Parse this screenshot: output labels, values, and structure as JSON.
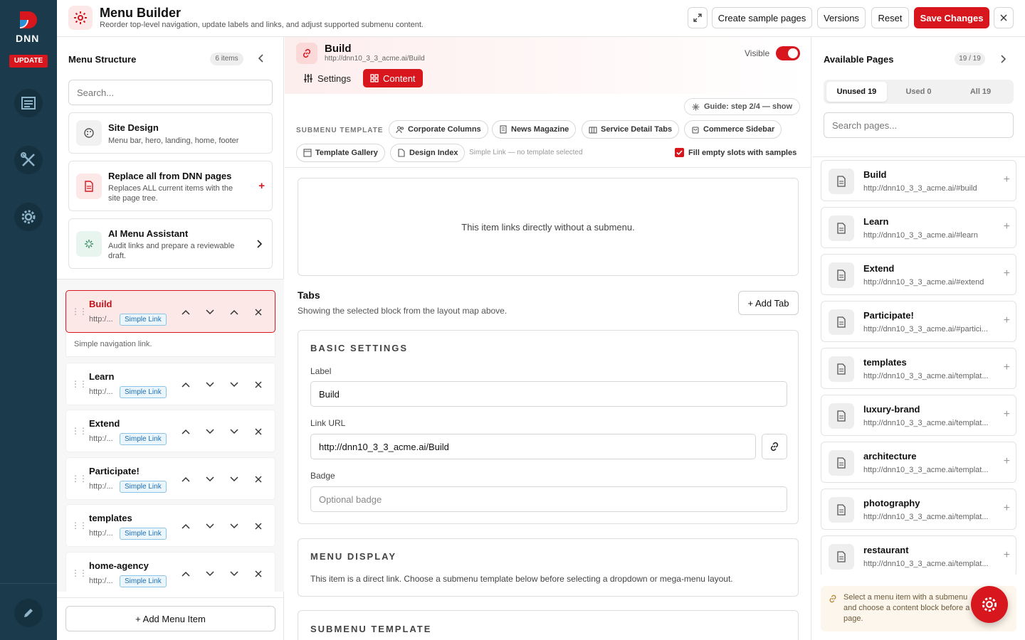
{
  "brand": {
    "logo_text": "DNN",
    "update_label": "UPDATE"
  },
  "header": {
    "title": "Menu Builder",
    "subtitle": "Reorder top-level navigation, update labels and links, and adjust supported submenu content.",
    "btn_sample": "Create sample pages",
    "btn_versions": "Versions",
    "btn_reset": "Reset",
    "btn_save": "Save Changes"
  },
  "left": {
    "title": "Menu Structure",
    "count": "6 items",
    "search_placeholder": "Search...",
    "cards": [
      {
        "title": "Site Design",
        "sub": "Menu bar, hero, landing, home, footer"
      },
      {
        "title": "Replace all from DNN pages",
        "sub": "Replaces ALL current items with the site page tree."
      },
      {
        "title": "AI Menu Assistant",
        "sub": "Audit links and prepare a reviewable draft."
      }
    ],
    "items": [
      {
        "name": "Build",
        "url": "http:/...",
        "tag": "Simple Link"
      },
      {
        "name": "Learn",
        "url": "http:/...",
        "tag": "Simple Link"
      },
      {
        "name": "Extend",
        "url": "http:/...",
        "tag": "Simple Link"
      },
      {
        "name": "Participate!",
        "url": "http:/...",
        "tag": "Simple Link"
      },
      {
        "name": "templates",
        "url": "http:/...",
        "tag": "Simple Link"
      },
      {
        "name": "home-agency",
        "url": "http:/...",
        "tag": "Simple Link"
      }
    ],
    "selected_note": "Simple navigation link.",
    "add_label": "+ Add Menu Item"
  },
  "center": {
    "title": "Build",
    "url": "http://dnn10_3_3_acme.ai/Build",
    "visible_label": "Visible",
    "tab_settings": "Settings",
    "tab_content": "Content",
    "guide": "Guide: step 2/4 — show",
    "template_label": "SUBMENU TEMPLATE",
    "chips": [
      "Corporate Columns",
      "News Magazine",
      "Service Detail Tabs",
      "Commerce Sidebar",
      "Template Gallery",
      "Design Index"
    ],
    "chip_note": "Simple Link — no template selected",
    "fill_label": "Fill empty slots with samples",
    "direct_msg": "This item links directly without a submenu.",
    "tabs_title": "Tabs",
    "tabs_sub": "Showing the selected block from the layout map above.",
    "add_tab": "+ Add Tab",
    "basic_title": "BASIC SETTINGS",
    "label_label": "Label",
    "label_value": "Build",
    "link_label": "Link URL",
    "link_value": "http://dnn10_3_3_acme.ai/Build",
    "badge_label": "Badge",
    "badge_placeholder": "Optional badge",
    "display_title": "MENU DISPLAY",
    "display_text": "This item is a direct link. Choose a submenu template below before selecting a dropdown or mega-menu layout.",
    "submenu_title": "SUBMENU TEMPLATE"
  },
  "right": {
    "title": "Available Pages",
    "count": "19 / 19",
    "seg_unused": "Unused 19",
    "seg_used": "Used 0",
    "seg_all": "All 19",
    "search_placeholder": "Search pages...",
    "pages": [
      {
        "name": "Build",
        "url": "http://dnn10_3_3_acme.ai/#build"
      },
      {
        "name": "Learn",
        "url": "http://dnn10_3_3_acme.ai/#learn"
      },
      {
        "name": "Extend",
        "url": "http://dnn10_3_3_acme.ai/#extend"
      },
      {
        "name": "Participate!",
        "url": "http://dnn10_3_3_acme.ai/#partici..."
      },
      {
        "name": "templates",
        "url": "http://dnn10_3_3_acme.ai/templat..."
      },
      {
        "name": "luxury-brand",
        "url": "http://dnn10_3_3_acme.ai/templat..."
      },
      {
        "name": "architecture",
        "url": "http://dnn10_3_3_acme.ai/templat..."
      },
      {
        "name": "photography",
        "url": "http://dnn10_3_3_acme.ai/templat..."
      },
      {
        "name": "restaurant",
        "url": "http://dnn10_3_3_acme.ai/templat..."
      }
    ],
    "hint": "Select a menu item with a submenu and choose a content block before a page."
  },
  "colors": {
    "accent": "#d7161e",
    "rail": "#1b3a4b"
  }
}
